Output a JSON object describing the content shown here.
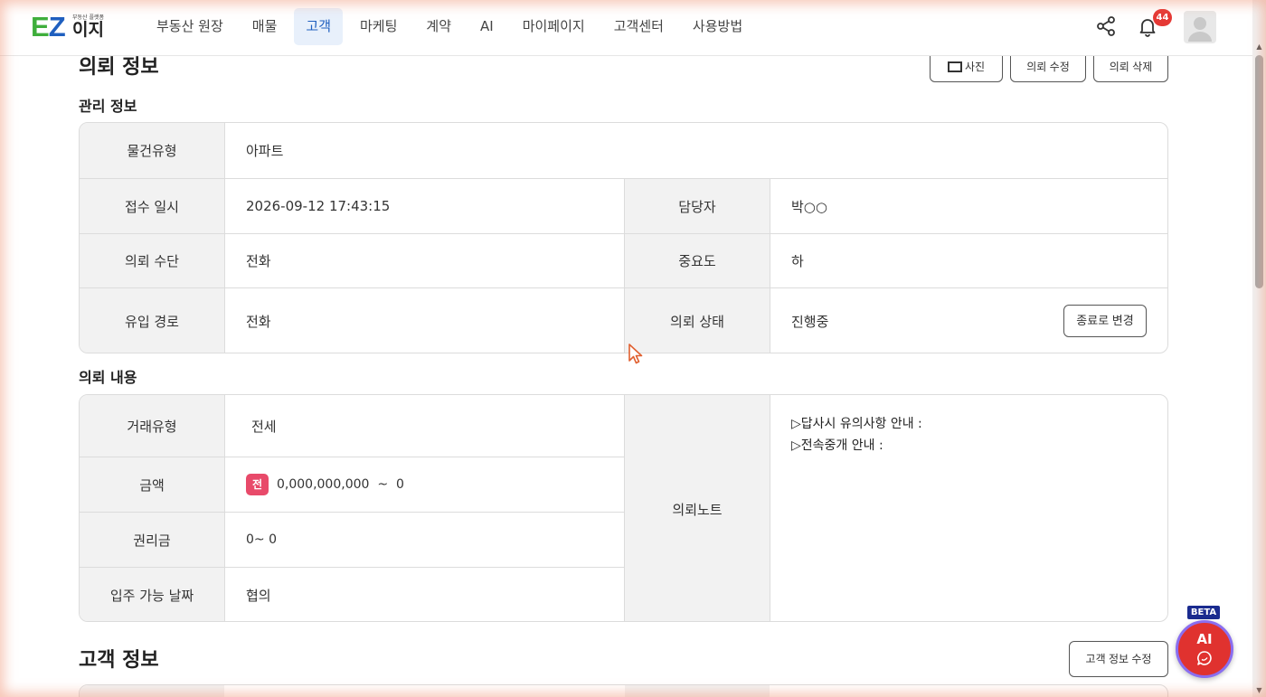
{
  "header": {
    "logo_brand_e": "E",
    "logo_brand_z": "Z",
    "logo_tagline": "부동산 플랫폼",
    "logo_name": "이지",
    "nav": [
      "부동산 원장",
      "매물",
      "고객",
      "마케팅",
      "계약",
      "AI",
      "마이페이지",
      "고객센터",
      "사용방법"
    ],
    "active_nav": "고객",
    "notification_count": "44"
  },
  "request_info": {
    "section_title": "의뢰 정보",
    "buttons": [
      "사진",
      "의뢰 수정",
      "의뢰 삭제"
    ]
  },
  "management": {
    "title": "관리 정보",
    "property_type_label": "물건유형",
    "property_type": "아파트",
    "received_at_label": "접수 일시",
    "received_at": "2026-09-12 17:43:15",
    "manager_label": "담당자",
    "manager": "박○○",
    "method_label": "의뢰 수단",
    "method": "전화",
    "importance_label": "중요도",
    "importance": "하",
    "channel_label": "유입 경로",
    "channel": "전화",
    "status_label": "의뢰 상태",
    "status": "진행중",
    "end_button": "종료로 변경"
  },
  "request_content": {
    "title": "의뢰 내용",
    "deal_type_label": "거래유형",
    "deal_type": "전세",
    "amount_label": "금액",
    "amount_tag": "전",
    "amount": "0,000,000,000  ~  0",
    "premium_label": "권리금",
    "premium": "0~ 0",
    "move_in_label": "입주 가능 날짜",
    "move_in": "협의",
    "note_label": "의뢰노트",
    "note_line1": "▷답사시 유의사항 안내 :",
    "note_line2": "▷전속중개 안내 :"
  },
  "customer": {
    "title": "고객 정보",
    "edit_button": "고객 정보 수정"
  },
  "ai_fab": {
    "beta": "BETA",
    "label": "AI"
  }
}
